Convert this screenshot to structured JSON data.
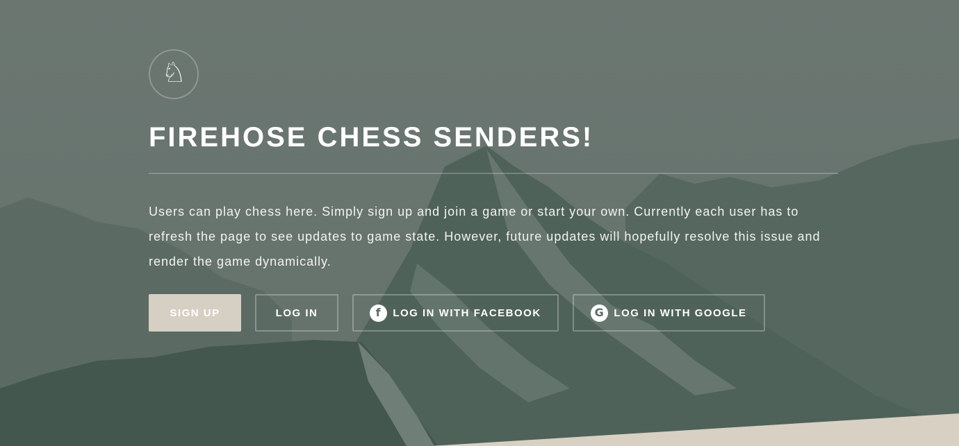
{
  "hero": {
    "logo_icon": "chess-knight-icon",
    "logo_glyph": "♘",
    "title": "FIREHOSE CHESS SENDERS!",
    "description": "Users can play chess here. Simply sign up and join a game or start your own. Currently each user has to refresh the page to see updates to game state. However, future updates will hopefully resolve this issue and render the game dynamically."
  },
  "buttons": {
    "signup": "SIGN UP",
    "login": "LOG IN",
    "facebook": "LOG IN WITH FACEBOOK",
    "facebook_icon": "f",
    "google": "LOG IN WITH GOOGLE",
    "google_icon": "G"
  },
  "colors": {
    "overlay": "#6a7770",
    "signup_bg": "#d6cfc3",
    "bottom_band": "#d8d0c3"
  }
}
